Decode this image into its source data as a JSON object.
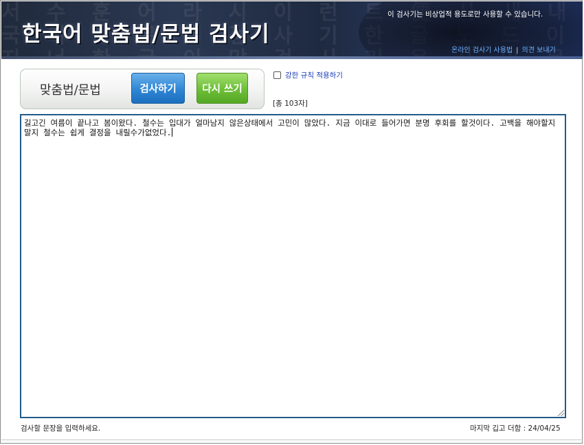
{
  "header": {
    "logo_text": "한국어 맞춤법/문법 검사기",
    "notice": "이 검사기는 비상업적 용도로만 사용할 수 있습니다.",
    "links": {
      "usage": "온라인 검사기 사용법",
      "separator": "|",
      "feedback": "의견 보내기"
    },
    "background_glyphs": [
      "서 수 훈 어 라 시 이 런 트 便 사 새 내 플",
      "국 이 맞 문 법 검 사 기 한 글 노 드 이 르",
      "지 너 한 글 이 맞 검 사 기 음 자 어 문 동"
    ]
  },
  "controls": {
    "title": "맞춤법/문법",
    "check_button": "검사하기",
    "reset_button": "다시 쓰기",
    "strict_checkbox_label": "강한 규칙 적용하기",
    "strict_checked": false,
    "char_count": "[총 103자]"
  },
  "editor": {
    "text": "길고긴 여름이 끝나고 봄이왔다. 철수는 입대가 얼마남지 않은상태에서 고민이 많았다. 지금 이대로 들어가면 분명 후회를 할것이다. 고백을 해야할지 말지 철수는 쉽게 결정을 내릴수가없었다."
  },
  "status": {
    "hint": "검사할 문장을 입력하세요.",
    "last_updated": "마지막 깁고 더함 : 24/04/25"
  },
  "colors": {
    "check_button": "#2f86d4",
    "reset_button": "#6dbe38",
    "editor_border": "#1f5a8a",
    "link": "#6fb3ff"
  }
}
